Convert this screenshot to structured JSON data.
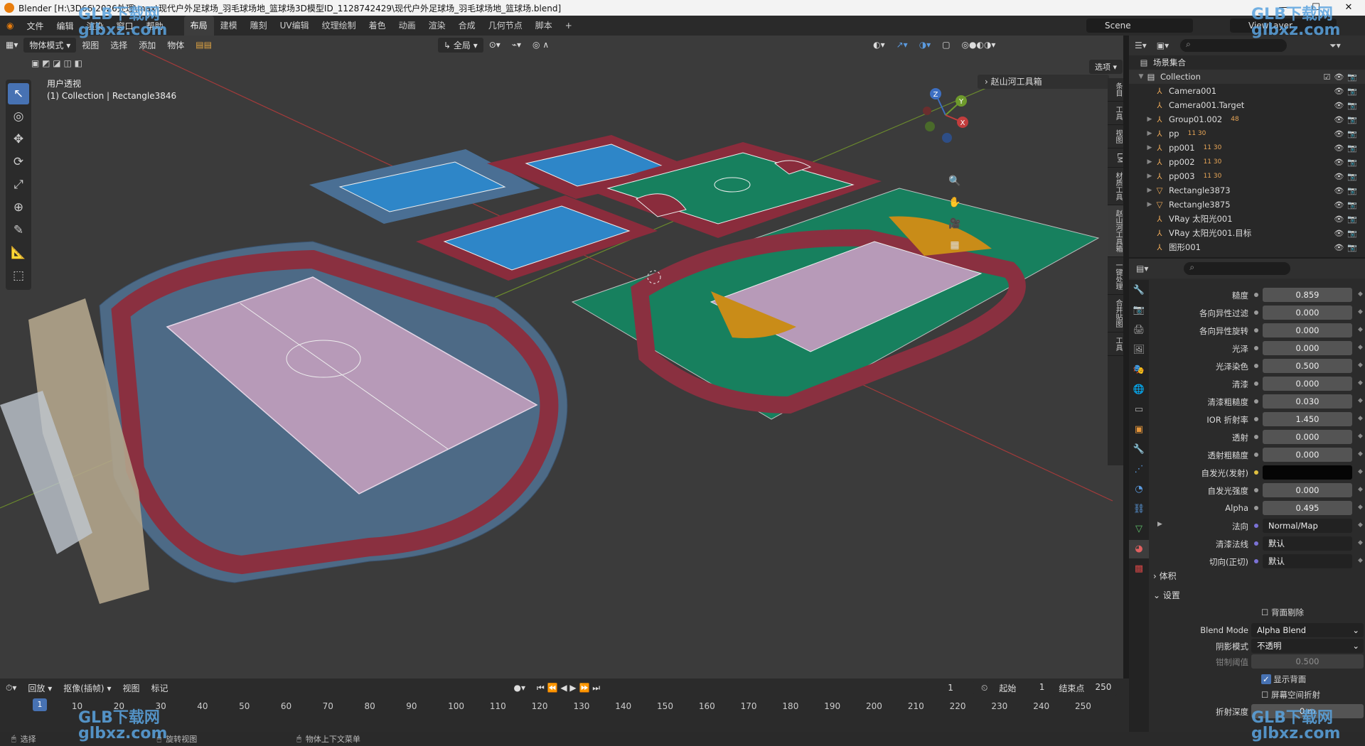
{
  "window": {
    "title": "Blender [H:\\3D66\\2026处理\\max\\现代户外足球场_羽毛球场地_篮球场3D模型ID_1128742429\\现代户外足球场_羽毛球场地_篮球场.blend]"
  },
  "menu": {
    "items": [
      "文件",
      "编辑",
      "渲染",
      "窗口",
      "帮助"
    ],
    "workspaces": [
      "布局",
      "建模",
      "雕刻",
      "UV编辑",
      "纹理绘制",
      "着色",
      "动画",
      "渲染",
      "合成",
      "几何节点",
      "脚本"
    ],
    "add": "+"
  },
  "scene": {
    "scene_name": "Scene",
    "view_layer": "ViewLayer"
  },
  "viewport_header": {
    "mode": "物体模式",
    "menus": [
      "视图",
      "选择",
      "添加",
      "物体"
    ],
    "transform": "全局",
    "options": "选项"
  },
  "viewport": {
    "view_name": "用户透视",
    "collection_info": "(1) Collection | Rectangle3846",
    "npanel_label": "赵山河工具箱"
  },
  "side_tabs": [
    "条目",
    "工具",
    "视图",
    "LM",
    "材质工具",
    "赵山河工具箱",
    "一键处理",
    "合并贴图",
    "工具"
  ],
  "gizmo": {
    "x": "X",
    "y": "Y",
    "z": "Z"
  },
  "outliner": {
    "root": "场景集合",
    "collection": "Collection",
    "items": [
      {
        "name": "Camera001",
        "badge": ""
      },
      {
        "name": "Camera001.Target",
        "badge": ""
      },
      {
        "name": "Group01.002",
        "badge": "48"
      },
      {
        "name": "pp",
        "badge": "11 30"
      },
      {
        "name": "pp001",
        "badge": "11 30"
      },
      {
        "name": "pp002",
        "badge": "11 30"
      },
      {
        "name": "pp003",
        "badge": "11 30"
      },
      {
        "name": "Rectangle3873",
        "badge": ""
      },
      {
        "name": "Rectangle3875",
        "badge": ""
      },
      {
        "name": "VRay 太阳光001",
        "badge": ""
      },
      {
        "name": "VRay 太阳光001.目标",
        "badge": ""
      },
      {
        "name": "图形001",
        "badge": ""
      }
    ]
  },
  "properties": {
    "rows": [
      {
        "label": "糙度",
        "value": "0.859",
        "fill": 0.859
      },
      {
        "label": "各向异性过滤",
        "value": "0.000",
        "fill": 0
      },
      {
        "label": "各向异性旋转",
        "value": "0.000",
        "fill": 0
      },
      {
        "label": "光泽",
        "value": "0.000",
        "fill": 0
      },
      {
        "label": "光泽染色",
        "value": "0.500",
        "fill": 0.5
      },
      {
        "label": "清漆",
        "value": "0.000",
        "fill": 0
      },
      {
        "label": "清漆粗糙度",
        "value": "0.030",
        "fill": 0.03
      },
      {
        "label": "IOR 折射率",
        "value": "1.450",
        "fill": 0
      },
      {
        "label": "透射",
        "value": "0.000",
        "fill": 0
      },
      {
        "label": "透射粗糙度",
        "value": "0.000",
        "fill": 0
      },
      {
        "label": "自发光(发射)",
        "value": "",
        "fill": 0
      },
      {
        "label": "自发光强度",
        "value": "0.000",
        "fill": 0
      },
      {
        "label": "Alpha",
        "value": "0.495",
        "fill": 0.495
      },
      {
        "label": "法向",
        "value": "Normal/Map",
        "fill": 0
      },
      {
        "label": "清漆法线",
        "value": "默认",
        "fill": 0
      },
      {
        "label": "切向(正切)",
        "value": "默认",
        "fill": 0
      }
    ],
    "section_volume": "体积",
    "section_settings": "设置",
    "backface_culling": "背面剔除",
    "blend_mode_label": "Blend Mode",
    "blend_mode": "Alpha Blend",
    "shadow_mode_label": "阴影模式",
    "shadow_mode": "不透明",
    "clip_label": "钳制阈值",
    "clip_value": "0.500",
    "show_backface": "显示背面",
    "screen_refraction": "屏幕空间折射",
    "refraction_depth_label": "折射深度",
    "refraction_depth": "0 m"
  },
  "timeline": {
    "menus": [
      "回放",
      "抠像(插帧)",
      "视图",
      "标记"
    ],
    "current_frame": "1",
    "start_label": "起始",
    "start": "1",
    "end_label": "结束点",
    "end": "250",
    "ticks": [
      "1",
      "10",
      "20",
      "30",
      "40",
      "50",
      "60",
      "70",
      "80",
      "90",
      "100",
      "110",
      "120",
      "130",
      "140",
      "150",
      "160",
      "170",
      "180",
      "190",
      "200",
      "210",
      "220",
      "230",
      "240",
      "250"
    ]
  },
  "statusbar": {
    "items": [
      "选择",
      "旋转视图",
      "物体上下文菜单"
    ]
  },
  "watermark": {
    "brand": "GLB下载网",
    "domain": "glbxz.com"
  }
}
